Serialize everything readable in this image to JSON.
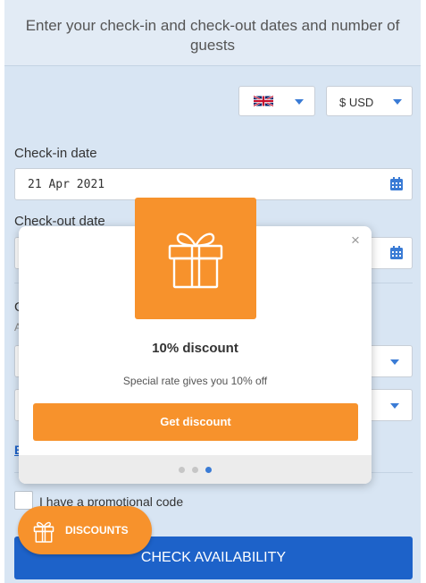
{
  "header": {
    "title": "Enter your check-in and check-out dates and number of guests"
  },
  "language": {
    "flag_icon": "uk-flag-icon"
  },
  "currency": {
    "value": "$ USD"
  },
  "checkin": {
    "label": "Check-in date",
    "value": "21 Apr 2021"
  },
  "checkout": {
    "label": "Check-out date"
  },
  "partial_texts": {
    "guests_label": "G",
    "guests_sub": "A",
    "link": "E"
  },
  "promo": {
    "label": "I have a promotional code"
  },
  "actions": {
    "check_availability": "CHECK AVAILABILITY"
  },
  "modal": {
    "title": "10% discount",
    "description": "Special rate gives you 10% off",
    "button": "Get discount",
    "close": "×",
    "dots": 3,
    "active_dot": 3
  },
  "discounts_button": {
    "label": "DISCOUNTS"
  },
  "colors": {
    "accent_orange": "#f7922c",
    "primary_blue": "#1d62c9",
    "panel_bg": "#d8e5f3"
  }
}
